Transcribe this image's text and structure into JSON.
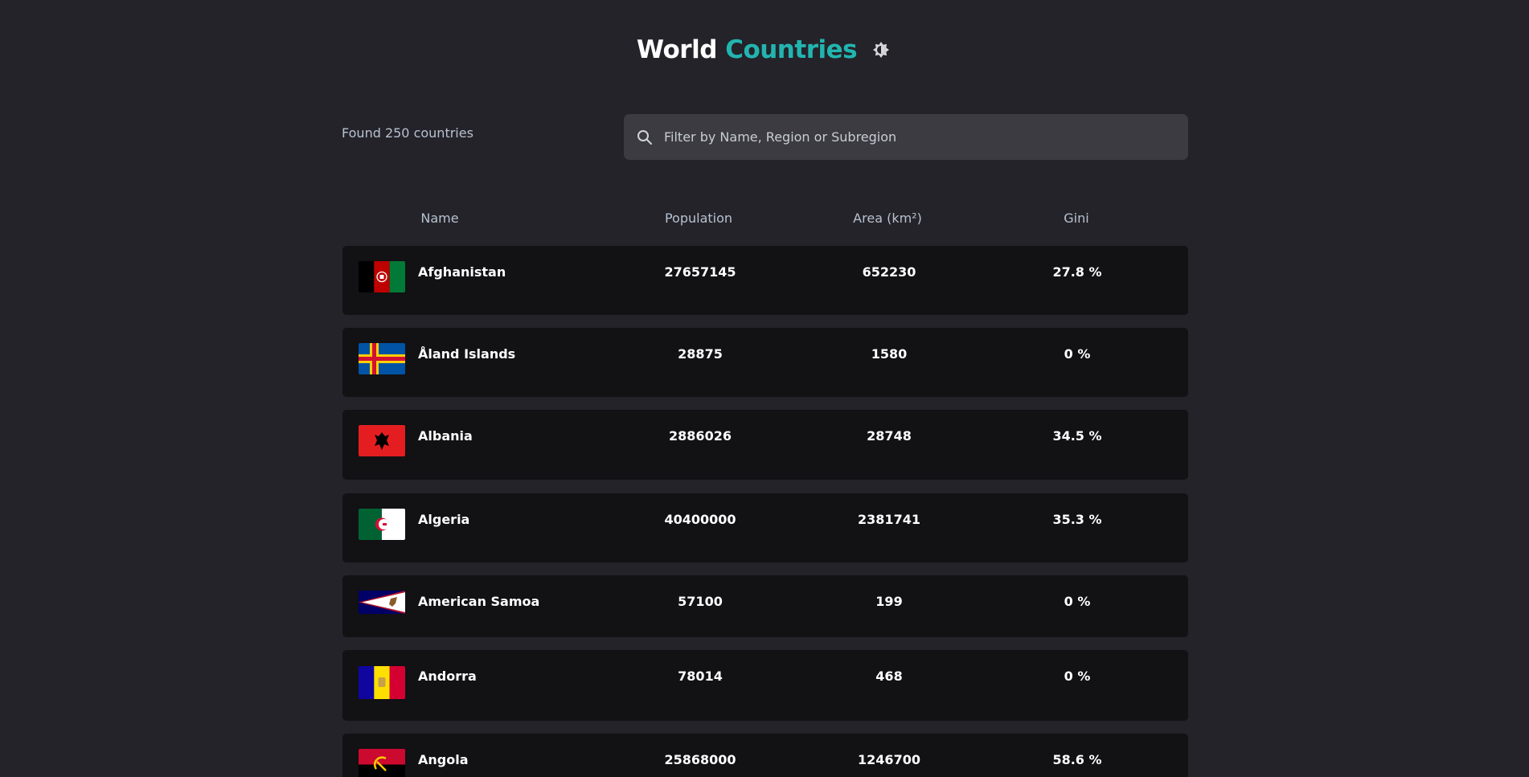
{
  "header": {
    "title_part1": "World",
    "title_part2": "Countries",
    "theme_icon": "brightness-icon",
    "accent_color": "#22b5b0"
  },
  "summary": {
    "found_text": "Found 250 countries"
  },
  "search": {
    "placeholder": "Filter by Name, Region or Subregion",
    "value": ""
  },
  "table": {
    "columns": [
      "Name",
      "Population",
      "Area (km²)",
      "Gini"
    ],
    "rows": [
      {
        "name": "Afghanistan",
        "population": "27657145",
        "area": "652230",
        "gini": "27.8 %",
        "flag": "afghanistan-flag"
      },
      {
        "name": "Åland Islands",
        "population": "28875",
        "area": "1580",
        "gini": "0 %",
        "flag": "aland-islands-flag"
      },
      {
        "name": "Albania",
        "population": "2886026",
        "area": "28748",
        "gini": "34.5 %",
        "flag": "albania-flag"
      },
      {
        "name": "Algeria",
        "population": "40400000",
        "area": "2381741",
        "gini": "35.3 %",
        "flag": "algeria-flag"
      },
      {
        "name": "American Samoa",
        "population": "57100",
        "area": "199",
        "gini": "0 %",
        "flag": "american-samoa-flag"
      },
      {
        "name": "Andorra",
        "population": "78014",
        "area": "468",
        "gini": "0 %",
        "flag": "andorra-flag"
      },
      {
        "name": "Angola",
        "population": "25868000",
        "area": "1246700",
        "gini": "58.6 %",
        "flag": "angola-flag"
      }
    ]
  }
}
